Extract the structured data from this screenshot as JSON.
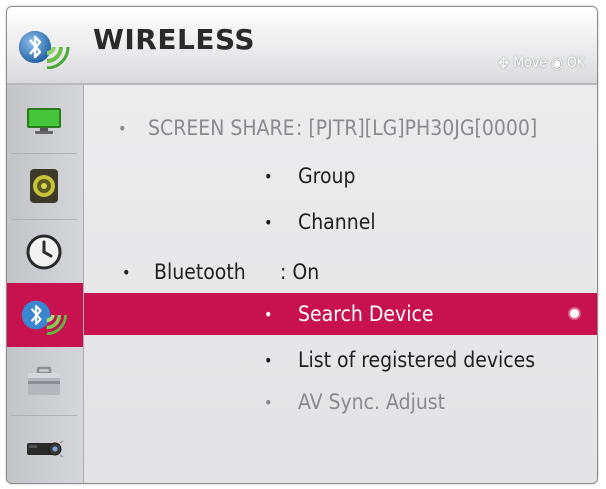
{
  "header": {
    "title": "WIRELESS",
    "hint": {
      "move_label": "Move",
      "ok_label": "OK",
      "move_icon": "dpad-icon",
      "ok_icon": "ok-circle-icon"
    }
  },
  "sidebar": {
    "items": [
      {
        "icon": "monitor-icon",
        "active": false
      },
      {
        "icon": "speaker-icon",
        "active": false
      },
      {
        "icon": "clock-icon",
        "active": false
      },
      {
        "icon": "bluetooth-wireless-icon",
        "active": true
      },
      {
        "icon": "toolbox-icon",
        "active": false
      },
      {
        "icon": "projector-icon",
        "active": false
      }
    ]
  },
  "menu": {
    "items": [
      {
        "label": "SCREEN SHARE",
        "value": ": [PJTR][LG]PH30JG[0000]",
        "state": "dim"
      },
      {
        "label": "Group",
        "state": "normal"
      },
      {
        "label": "Channel",
        "state": "normal"
      },
      {
        "label": "Bluetooth",
        "value": ": On",
        "state": "normal"
      },
      {
        "label": "Search Device",
        "state": "selected"
      },
      {
        "label": "List of registered devices",
        "state": "normal"
      },
      {
        "label": "AV Sync. Adjust",
        "state": "dim"
      }
    ]
  },
  "colors": {
    "accent": "#c8114f",
    "panel_bg": "#e9e9ea",
    "dim_text": "#8a8a8e",
    "text": "#1f1f1f"
  }
}
